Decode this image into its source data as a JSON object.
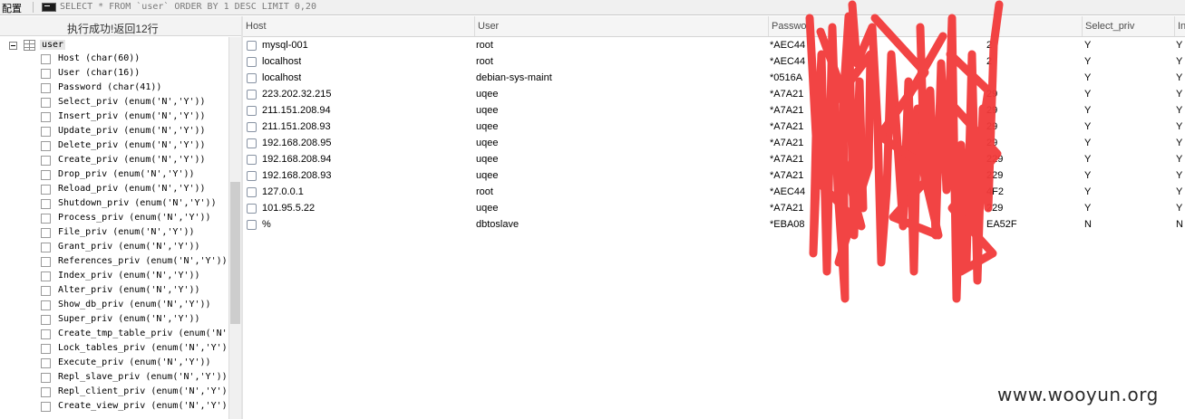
{
  "toolbar": {
    "config_label": "配置",
    "query_text": "SELECT * FROM `user` ORDER BY 1 DESC LIMIT 0,20"
  },
  "status": {
    "message": "执行成功!返回12行"
  },
  "tree": {
    "table_name": "user",
    "columns": [
      "Host (char(60))",
      "User (char(16))",
      "Password (char(41))",
      "Select_priv (enum('N','Y'))",
      "Insert_priv (enum('N','Y'))",
      "Update_priv (enum('N','Y'))",
      "Delete_priv (enum('N','Y'))",
      "Create_priv (enum('N','Y'))",
      "Drop_priv (enum('N','Y'))",
      "Reload_priv (enum('N','Y'))",
      "Shutdown_priv (enum('N','Y'))",
      "Process_priv (enum('N','Y'))",
      "File_priv (enum('N','Y'))",
      "Grant_priv (enum('N','Y'))",
      "References_priv (enum('N','Y'))",
      "Index_priv (enum('N','Y'))",
      "Alter_priv (enum('N','Y'))",
      "Show_db_priv (enum('N','Y'))",
      "Super_priv (enum('N','Y'))",
      "Create_tmp_table_priv (enum('N'",
      "Lock_tables_priv (enum('N','Y')",
      "Execute_priv (enum('N','Y'))",
      "Repl_slave_priv (enum('N','Y'))",
      "Repl_client_priv (enum('N','Y')",
      "Create_view_priv (enum('N','Y'))"
    ]
  },
  "grid": {
    "headers": [
      "Host",
      "User",
      "Passwo",
      "Select_priv",
      "In"
    ],
    "rows": [
      {
        "host": "mysql-001",
        "user": "root",
        "password": "*AEC44",
        "password_tail": "2",
        "select": "Y",
        "insert": "Y"
      },
      {
        "host": "localhost",
        "user": "root",
        "password": "*AEC44",
        "password_tail": "2",
        "select": "Y",
        "insert": "Y"
      },
      {
        "host": "localhost",
        "user": "debian-sys-maint",
        "password": "*0516A",
        "password_tail": "",
        "select": "Y",
        "insert": "Y"
      },
      {
        "host": "223.202.32.215",
        "user": "uqee",
        "password": "*A7A21",
        "password_tail": "29",
        "select": "Y",
        "insert": "Y"
      },
      {
        "host": "211.151.208.94",
        "user": "uqee",
        "password": "*A7A21",
        "password_tail": "29",
        "select": "Y",
        "insert": "Y"
      },
      {
        "host": "211.151.208.93",
        "user": "uqee",
        "password": "*A7A21",
        "password_tail": "29",
        "select": "Y",
        "insert": "Y"
      },
      {
        "host": "192.168.208.95",
        "user": "uqee",
        "password": "*A7A21",
        "password_tail": "29",
        "select": "Y",
        "insert": "Y"
      },
      {
        "host": "192.168.208.94",
        "user": "uqee",
        "password": "*A7A21",
        "password_tail": "229",
        "select": "Y",
        "insert": "Y"
      },
      {
        "host": "192.168.208.93",
        "user": "uqee",
        "password": "*A7A21",
        "password_tail": "229",
        "select": "Y",
        "insert": "Y"
      },
      {
        "host": "127.0.0.1",
        "user": "root",
        "password": "*AEC44",
        "password_tail": "4F2",
        "select": "Y",
        "insert": "Y"
      },
      {
        "host": "101.95.5.22",
        "user": "uqee",
        "password": "*A7A21",
        "password_tail": "229",
        "select": "Y",
        "insert": "Y"
      },
      {
        "host": "%",
        "user": "dbtoslave",
        "password": "*EBA08",
        "password_tail": "EA52F",
        "select": "N",
        "insert": "N"
      }
    ]
  },
  "watermark": "www.wooyun.org",
  "colors": {
    "redaction": "#f23a3a",
    "header_bg": "#f5f5f5",
    "selection_bg": "#e6e6e6"
  }
}
